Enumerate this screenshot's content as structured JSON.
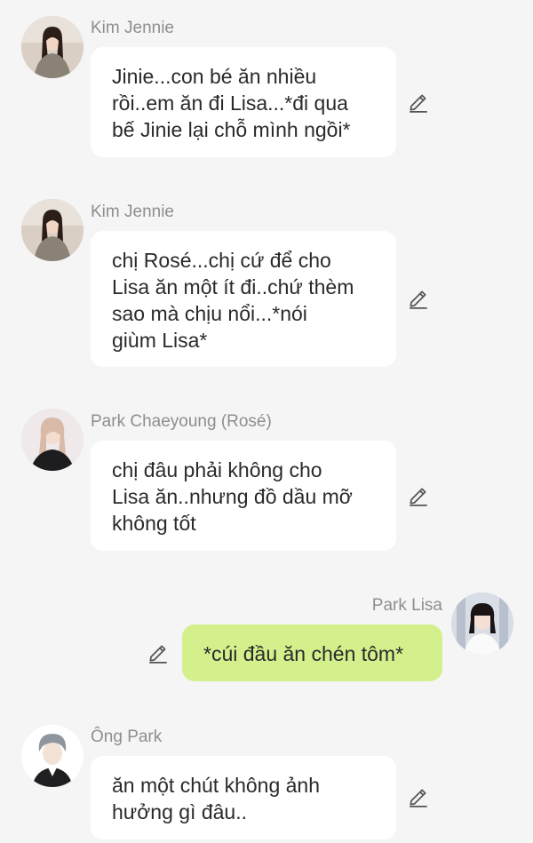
{
  "messages": [
    {
      "sender": "Kim Jennie",
      "text": "Jinie...con bé ăn nhiều\nrồi..em ăn đi Lisa...*đi qua\nbế Jinie lại chỗ mình ngồi*",
      "side": "left",
      "avatar_icon": "jennie-avatar-icon"
    },
    {
      "sender": "Kim Jennie",
      "text": "chị Rosé...chị cứ để cho\nLisa ăn một ít đi..chứ thèm\nsao mà chịu nổi...*nói\ngiùm Lisa*",
      "side": "left",
      "avatar_icon": "jennie-avatar-icon"
    },
    {
      "sender": "Park Chaeyoung (Rosé)",
      "text": "chị đâu phải không cho\nLisa ăn..nhưng đồ dầu mỡ\nkhông tốt",
      "side": "left",
      "avatar_icon": "rose-avatar-icon"
    },
    {
      "sender": "Park Lisa",
      "text": "*cúi đầu ăn chén tôm*",
      "side": "right",
      "avatar_icon": "lisa-avatar-icon"
    },
    {
      "sender": "Ông Park",
      "text": "ăn một chút không ảnh\nhưởng gì đâu..",
      "side": "left",
      "avatar_icon": "ong-park-avatar-icon"
    }
  ],
  "colors": {
    "background": "#f5f5f5",
    "bubble_left": "#ffffff",
    "bubble_right": "#d4f08c",
    "sender_name": "#8e8e8e",
    "text": "#2a2a2a"
  }
}
